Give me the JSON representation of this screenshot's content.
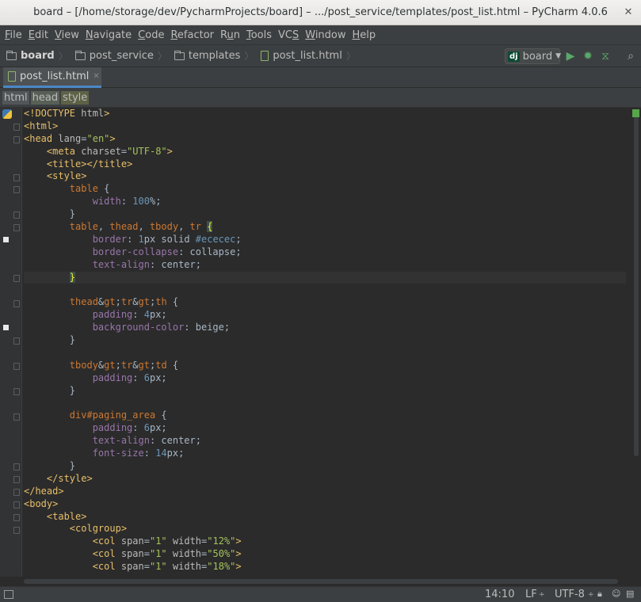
{
  "window": {
    "title": "board – [/home/storage/dev/PycharmProjects/board] – .../post_service/templates/post_list.html – PyCharm 4.0.6"
  },
  "menu": [
    "File",
    "Edit",
    "View",
    "Navigate",
    "Code",
    "Refactor",
    "Run",
    "Tools",
    "VCS",
    "Window",
    "Help"
  ],
  "menu_mnemonics": [
    "F",
    "E",
    "V",
    "N",
    "C",
    "R",
    "u",
    "T",
    "S",
    "W",
    "H"
  ],
  "navbar": {
    "crumbs": [
      "board",
      "post_service",
      "templates",
      "post_list.html"
    ],
    "run_config": "board",
    "run_config_badge": "dj"
  },
  "tabs": [
    {
      "label": "post_list.html",
      "active": true
    }
  ],
  "tag_path": [
    "html",
    "head",
    "style"
  ],
  "editor": {
    "current_line_index": 13
  },
  "code": [
    "<!DOCTYPE html>",
    "<html>",
    "<head lang=\"en\">",
    "    <meta charset=\"UTF-8\">",
    "    <title></title>",
    "    <style>",
    "        table {",
    "            width: 100%;",
    "        }",
    "        table, thead, tbody, tr {",
    "            border: 1px solid #ececec;",
    "            border-collapse: collapse;",
    "            text-align: center;",
    "        }",
    "",
    "        thead>tr>th {",
    "            padding: 4px;",
    "            background-color: beige;",
    "        }",
    "",
    "        tbody>tr>td {",
    "            padding: 6px;",
    "        }",
    "",
    "        div#paging_area {",
    "            padding: 6px;",
    "            text-align: center;",
    "            font-size: 14px;",
    "        }",
    "    </style>",
    "</head>",
    "<body>",
    "    <table>",
    "        <colgroup>",
    "            <col span=\"1\" width=\"12%\">",
    "            <col span=\"1\" width=\"50%\">",
    "            <col span=\"1\" width=\"18%\">"
  ],
  "status": {
    "position": "14:10",
    "line_sep": "LF",
    "encoding": "UTF-8"
  },
  "colors": {
    "tag": "#e8bf6a",
    "attr_value": "#a5c25c",
    "selector": "#cc7832",
    "property": "#9876aa",
    "number": "#6897bb",
    "text": "#a9b7c6"
  }
}
